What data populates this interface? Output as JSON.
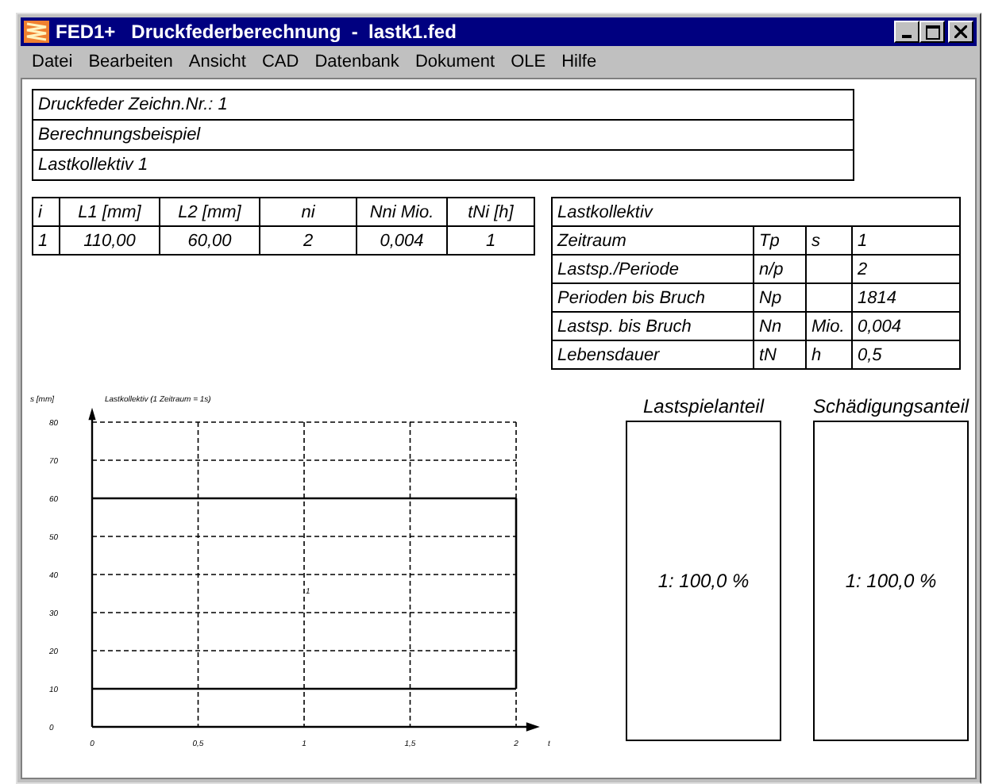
{
  "window": {
    "title": "FED1+   Druckfederberechnung  -  lastk1.fed"
  },
  "menu": [
    "Datei",
    "Bearbeiten",
    "Ansicht",
    "CAD",
    "Datenbank",
    "Dokument",
    "OLE",
    "Hilfe"
  ],
  "header_rows": [
    "Druckfeder  Zeichn.Nr.: 1",
    "Berechnungsbeispiel",
    "Lastkollektiv 1"
  ],
  "load_table": {
    "columns": [
      "i",
      "L1 [mm]",
      "L2 [mm]",
      "ni",
      "Nni Mio.",
      "tNi [h]"
    ],
    "rows": [
      [
        "1",
        "110,00",
        "60,00",
        "2",
        "0,004",
        "1"
      ]
    ]
  },
  "summary": {
    "title": "Lastkollektiv",
    "rows": [
      {
        "label": "Zeitraum",
        "symbol": "Tp",
        "unit": "s",
        "value": "1"
      },
      {
        "label": "Lastsp./Periode",
        "symbol": "n/p",
        "value": "2"
      },
      {
        "label": "Perioden bis Bruch",
        "symbol": "Np",
        "value": "1814"
      },
      {
        "label": "Lastsp. bis Bruch",
        "symbol": "Nn",
        "unit": "Mio.",
        "value": "0,004"
      },
      {
        "label": "Lebensdauer",
        "symbol": "tN",
        "unit": "h",
        "value": "0,5"
      }
    ]
  },
  "chart": {
    "chart_data": {
      "type": "line",
      "title": "Lastkollektiv (1 Zeitraum = 1s)",
      "xlabel": "t",
      "ylabel": "s [mm]",
      "x": [
        0,
        1,
        2
      ],
      "grid": true,
      "series": [
        {
          "name": "1",
          "color": "#000000",
          "values": [
            60,
            60,
            60
          ]
        },
        {
          "color": "#000000",
          "values": [
            10,
            10,
            10
          ]
        }
      ],
      "xlim": [
        0,
        2
      ],
      "ylim": [
        0,
        80
      ],
      "xticks": [
        0,
        {
          "value": 0.5,
          "label": "0,5"
        },
        1,
        {
          "value": 1.5,
          "label": "1,5"
        },
        2
      ],
      "yticks": [
        0,
        10,
        20,
        30,
        40,
        50,
        60,
        70,
        80
      ]
    }
  },
  "shares": [
    {
      "title": "Lastspielanteil",
      "entries": [
        "1: 100,0 %"
      ]
    },
    {
      "title": "Schädigungsanteil",
      "entries": [
        "1: 100,0 %"
      ]
    }
  ]
}
